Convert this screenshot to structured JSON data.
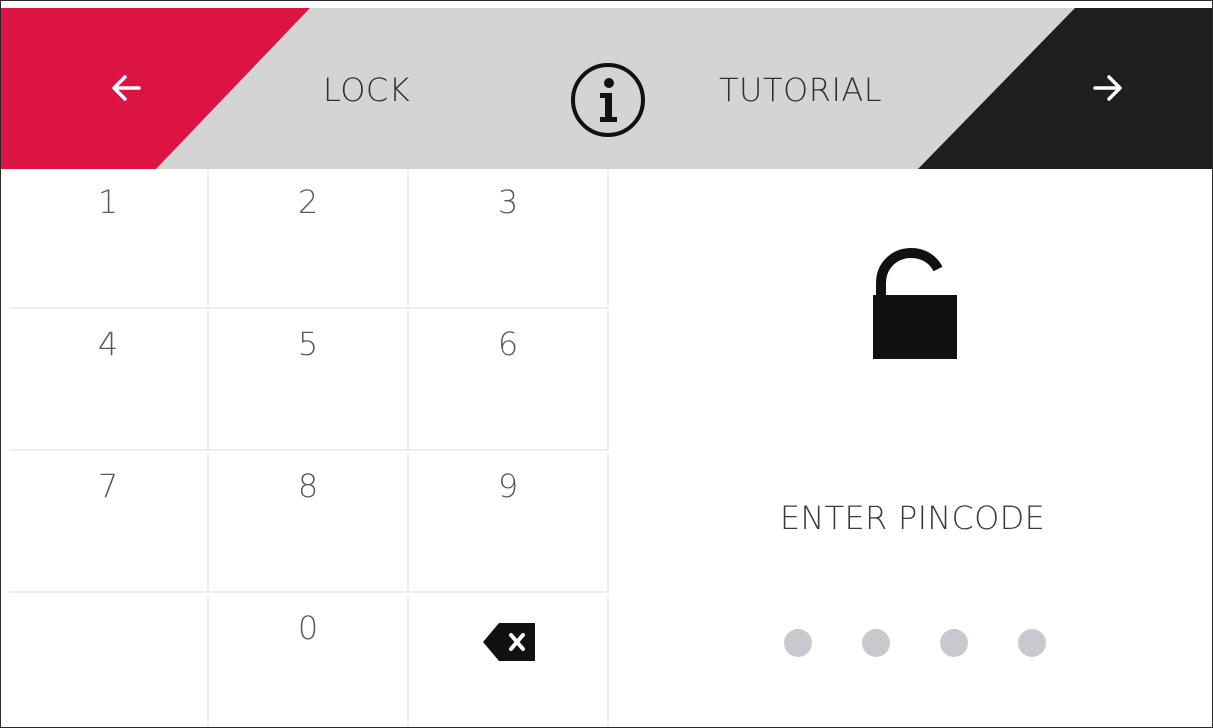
{
  "header": {
    "back_label": "LOCK",
    "tutorial_label": "TUTORIAL",
    "back_icon": "arrow-left-icon",
    "info_icon": "info-icon",
    "forward_icon": "arrow-right-icon"
  },
  "keypad": {
    "keys": [
      {
        "label": "1"
      },
      {
        "label": "2"
      },
      {
        "label": "3"
      },
      {
        "label": "4"
      },
      {
        "label": "5"
      },
      {
        "label": "6"
      },
      {
        "label": "7"
      },
      {
        "label": "8"
      },
      {
        "label": "9"
      },
      {
        "label": ""
      },
      {
        "label": "0"
      },
      {
        "label": "",
        "icon": "backspace-icon"
      }
    ]
  },
  "lock_panel": {
    "icon": "unlocked-padlock-icon",
    "prompt": "ENTER PINCODE",
    "pin_length": 4,
    "pin_entered": 0
  },
  "colors": {
    "back_accent": "#dc1444",
    "header_mid": "#d4d4d4",
    "header_dark": "#1e1e20",
    "dot_empty": "#c8c9cf"
  }
}
